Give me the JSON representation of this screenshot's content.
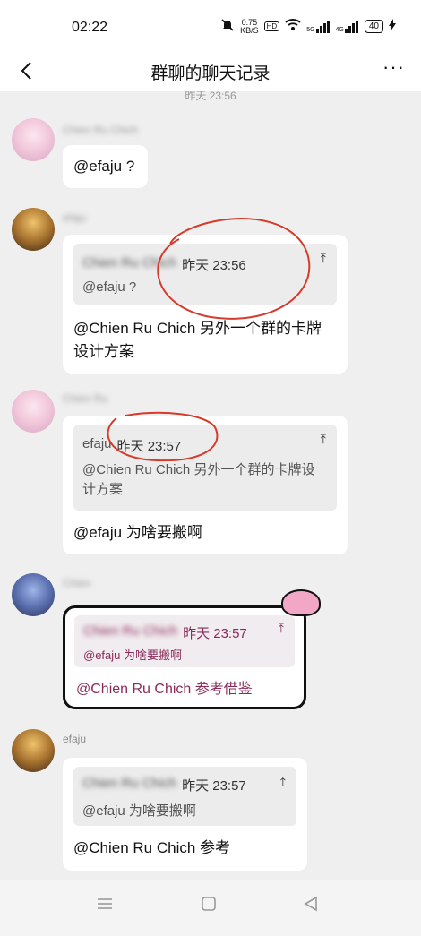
{
  "status": {
    "time": "02:22",
    "speed_value": "0.75",
    "speed_unit": "KB/S",
    "hd": "HD",
    "sig1": "5G",
    "sig2": "4G",
    "battery": "40"
  },
  "header": {
    "title": "群聊的聊天记录",
    "more": "···"
  },
  "time_separator": "昨天 23:56",
  "messages": [
    {
      "sender": "Chien Ru Chich",
      "text": "@efaju ?"
    },
    {
      "sender": "efaju",
      "quote_author": "Chien Ru Chich",
      "quote_time": "昨天 23:56",
      "quote_text": "@efaju ?",
      "text": "@Chien Ru Chich 另外一个群的卡牌设计方案"
    },
    {
      "sender": "Chien Ru",
      "quote_author": "efaju",
      "quote_time": "昨天 23:57",
      "quote_text": "@Chien Ru Chich 另外一个群的卡牌设计方案",
      "text": "@efaju 为啥要搬啊"
    },
    {
      "sender": "Chien",
      "quote_author": "Chien Ru Chich",
      "quote_time": "昨天 23:57",
      "quote_text": "@efaju 为啥要搬啊",
      "text": "@Chien Ru Chich 参考借鉴"
    },
    {
      "sender": "efaju",
      "quote_author": "Chien Ru Chich",
      "quote_time": "昨天 23:57",
      "quote_text": "@efaju 为啥要搬啊",
      "text": "@Chien Ru Chich 参考"
    }
  ],
  "colors": {
    "annotation": "#d63a2a",
    "pink_text": "#8a2a5a"
  }
}
